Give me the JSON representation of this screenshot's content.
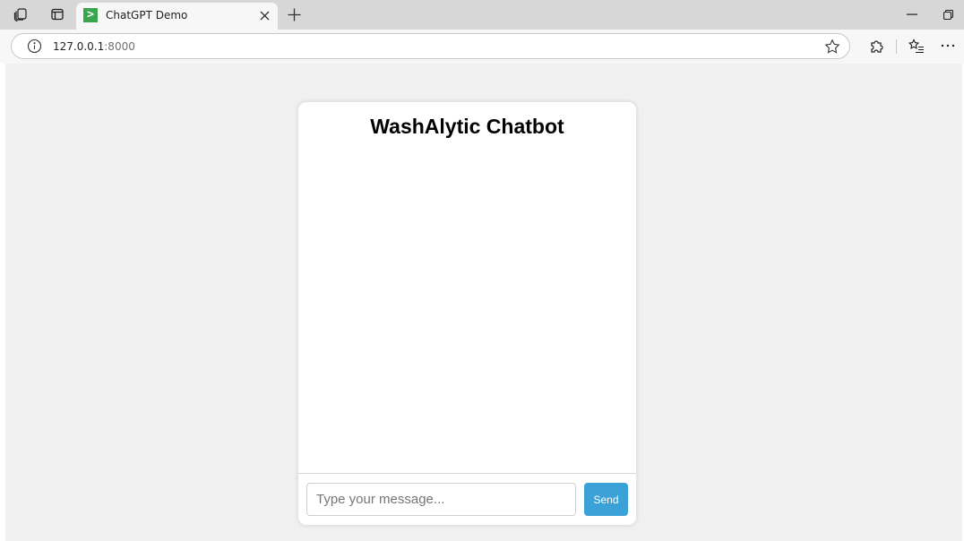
{
  "browser": {
    "tab": {
      "title": "ChatGPT Demo",
      "favicon_glyph": ">",
      "favicon_color": "#3aa64b"
    },
    "address": {
      "host": "127.0.0.1",
      "port": ":8000"
    },
    "icons": {
      "workspaces": "workspaces-icon",
      "tab_actions": "tab-actions-icon",
      "close_tab": "close-icon",
      "new_tab": "plus-icon",
      "minimize": "minimize-icon",
      "restore": "restore-icon",
      "site_info": "info-icon",
      "favorite": "star-icon",
      "extensions": "puzzle-icon",
      "favorites_bar": "favorites-list-icon",
      "menu": "more-icon"
    }
  },
  "chat": {
    "title": "WashAlytic Chatbot",
    "input_placeholder": "Type your message...",
    "input_value": "",
    "send_label": "Send",
    "accent_color": "#3aa2d6",
    "messages": []
  }
}
